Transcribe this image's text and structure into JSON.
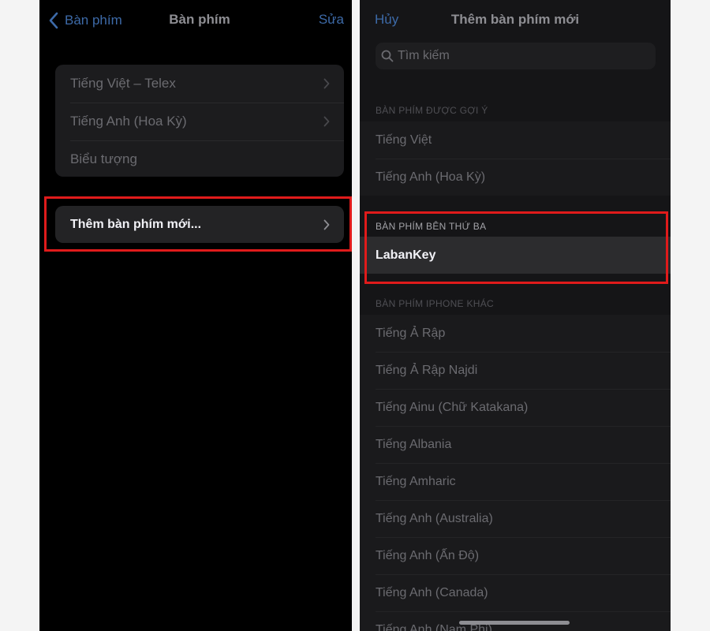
{
  "left": {
    "back_label": "Bàn phím",
    "title": "Bàn phím",
    "edit_label": "Sửa",
    "keyboards": [
      {
        "label": "Tiếng Việt – Telex",
        "has_chevron": true
      },
      {
        "label": "Tiếng Anh (Hoa Kỳ)",
        "has_chevron": true
      },
      {
        "label": "Biểu tượng",
        "has_chevron": false
      }
    ],
    "add_keyboard_label": "Thêm bàn phím mới..."
  },
  "right": {
    "cancel_label": "Hủy",
    "title": "Thêm bàn phím mới",
    "search_placeholder": "Tìm kiếm",
    "suggested_header": "BÀN PHÍM ĐƯỢC GỢI Ý",
    "suggested": [
      "Tiếng Việt",
      "Tiếng Anh (Hoa Kỳ)"
    ],
    "third_party_header": "BÀN PHÍM BÊN THỨ BA",
    "third_party": [
      "LabanKey"
    ],
    "other_header": "BÀN PHÍM IPHONE KHÁC",
    "other": [
      "Tiếng Ả Rập",
      "Tiếng Ả Rập Najdi",
      "Tiếng Ainu (Chữ Katakana)",
      "Tiếng Albania",
      "Tiếng Amharic",
      "Tiếng Anh (Australia)",
      "Tiếng Anh (Ấn Độ)",
      "Tiếng Anh (Canada)",
      "Tiếng Anh (Nam Phi)"
    ]
  },
  "icons": {
    "back": "chevron-left-icon",
    "row_chevron": "chevron-right-icon",
    "search": "magnifier-icon"
  },
  "colors": {
    "accent": "#3d6aa8",
    "highlight": "#e01b1b",
    "background": "#000000"
  }
}
